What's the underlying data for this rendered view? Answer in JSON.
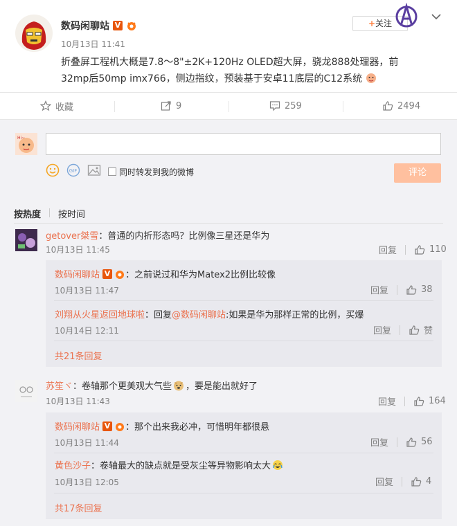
{
  "post": {
    "author": "数码闲聊站",
    "timestamp": "10月13日 11:41",
    "text_line1": "折叠屏工程机大概是7.8～8\"±2K+120Hz OLED超大屏，骁龙888处理器，前",
    "text_line2": "32mp后50mp imx766，侧边指纹，预装基于安卓11底层的C12系统",
    "follow_label": "+关注",
    "follow_plus": "+",
    "follow_text": "关注"
  },
  "actions": {
    "favorite": "收藏",
    "repost": "9",
    "comment": "259",
    "like": "2494"
  },
  "composer": {
    "repost_checkbox_label": "同时转发到我的微博",
    "submit": "评论",
    "placeholder": ""
  },
  "sort": {
    "hot": "按热度",
    "time": "按时间"
  },
  "comments": [
    {
      "author": "getover桀雪",
      "text": "：普通的内折形态吗？比例像三星还是华为",
      "time": "10月13日 11:45",
      "reply": "回复",
      "likes": "110",
      "replies": [
        {
          "author": "数码闲聊站",
          "text": "：之前说过和华为Matex2比例比较像",
          "time": "10月13日 11:47",
          "reply": "回复",
          "likes": "38"
        },
        {
          "author": "刘翔从火星返回地球啦",
          "prefix": "：回复",
          "mention": "@数码闲聊站",
          "text": ":如果是华为那样正常的比例，买爆",
          "time": "10月14日 12:11",
          "reply": "回复",
          "likes": "赞"
        }
      ],
      "more": "共21条回复"
    },
    {
      "author": "苏笙ヾ",
      "text": "：卷轴那个更美观大气些",
      "text_tail": "，要是能出就好了",
      "time": "10月13日 11:43",
      "reply": "回复",
      "likes": "164",
      "replies": [
        {
          "author": "数码闲聊站",
          "text": "：那个出来我必冲，可惜明年都很悬",
          "time": "10月13日 11:44",
          "reply": "回复",
          "likes": "56"
        },
        {
          "author": "黄色沙子",
          "text": "：卷轴最大的缺点就是受灰尘等异物影响太大",
          "time": "10月13日 12:05",
          "reply": "回复",
          "likes": "4"
        }
      ],
      "more": "共17条回复"
    }
  ],
  "colors": {
    "name": "#eb7350",
    "gray": "#808080",
    "submit_bg": "#ffc09f",
    "comment_bg": "#f2f2f5",
    "reply_bg": "#e9e9ee"
  }
}
